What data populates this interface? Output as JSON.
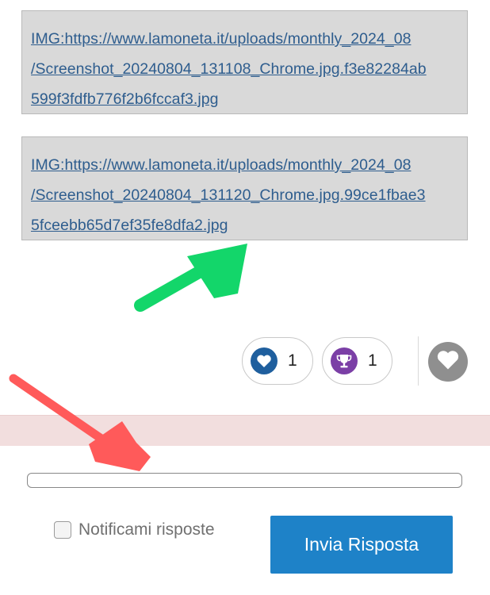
{
  "attachments": [
    {
      "line1": "IMG:https://www.lamoneta.it/uploads/monthly_2024_08",
      "line2": "/Screenshot_20240804_131108_Chrome.jpg.f3e82284ab",
      "line3": "599f3fdfb776f2b6fccaf3.jpg"
    },
    {
      "line1": "IMG:https://www.lamoneta.it/uploads/monthly_2024_08",
      "line2": "/Screenshot_20240804_131120_Chrome.jpg.99ce1fbae3",
      "line3": "5fceebb65d7ef35fe8dfa2.jpg"
    }
  ],
  "reactions": [
    {
      "icon": "heart-icon",
      "count": "1",
      "color": "#1f5f9e"
    },
    {
      "icon": "trophy-icon",
      "count": "1",
      "color": "#7b3fa6"
    }
  ],
  "favorite": {
    "icon": "heart-icon",
    "color": "#8f8f8f"
  },
  "reply": {
    "placeholder": ""
  },
  "notify": {
    "label": "Notificami risposte"
  },
  "submit": {
    "label": "Invia Risposta"
  },
  "annotations": {
    "green_arrow_color": "#13d66a",
    "red_arrow_color": "#ff5a5a"
  }
}
